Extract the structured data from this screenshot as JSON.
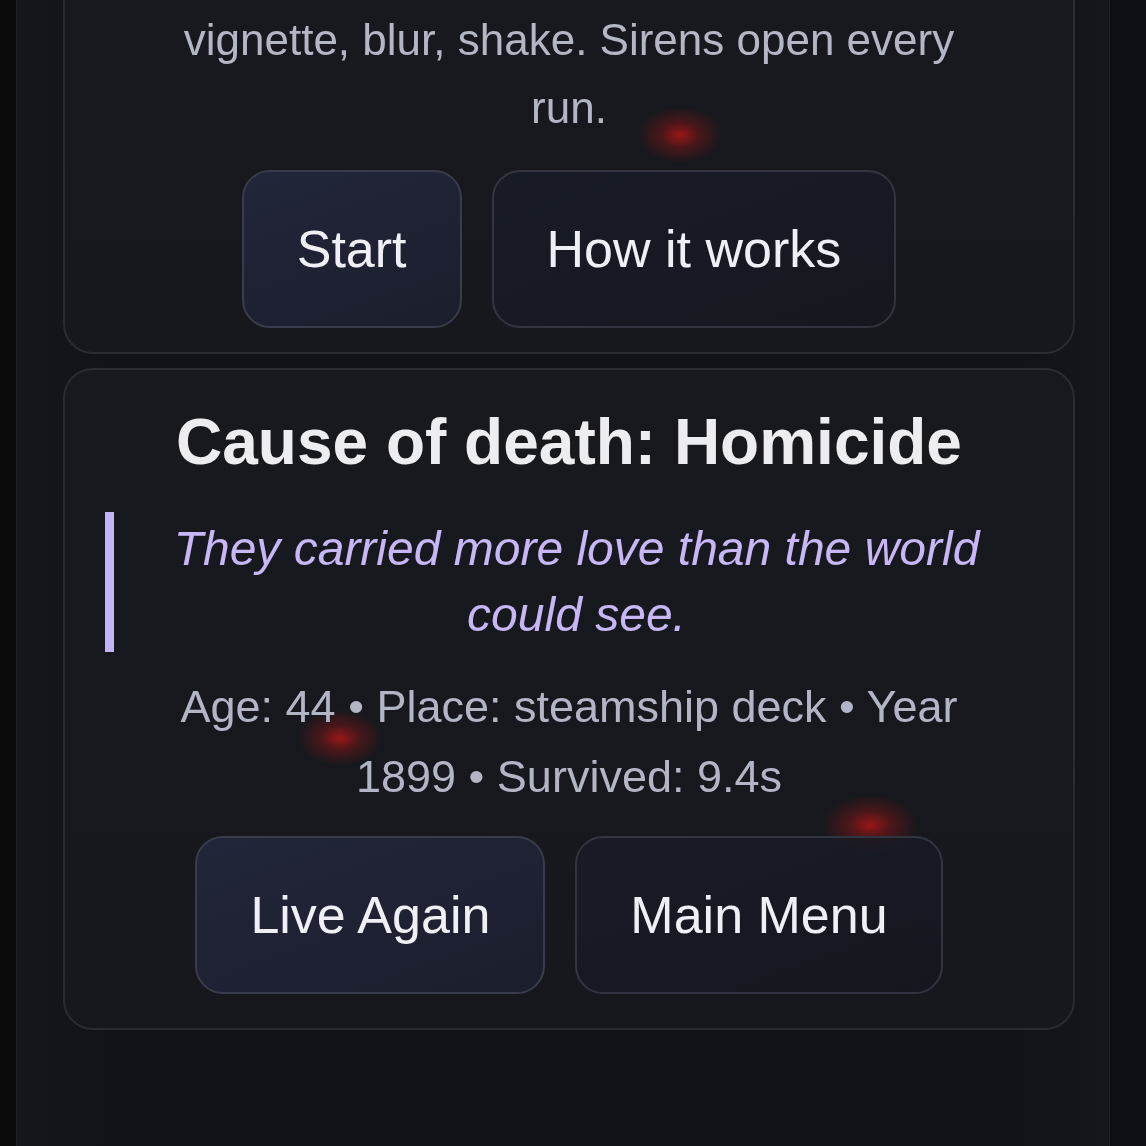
{
  "intro": {
    "text": "vignette, blur, shake. Sirens open every run.",
    "buttons": [
      {
        "label": "Start",
        "kind": "primary"
      },
      {
        "label": "How it works",
        "kind": "secondary"
      }
    ]
  },
  "result": {
    "title": "Cause of death: Homicide",
    "epitaph": "They carried more love than the world could see.",
    "details": "Age: 44 • Place: steamship deck • Year 1899 • Survived: 9.4s",
    "buttons": [
      {
        "label": "Live Again",
        "kind": "primary"
      },
      {
        "label": "Main Menu",
        "kind": "secondary"
      }
    ]
  }
}
